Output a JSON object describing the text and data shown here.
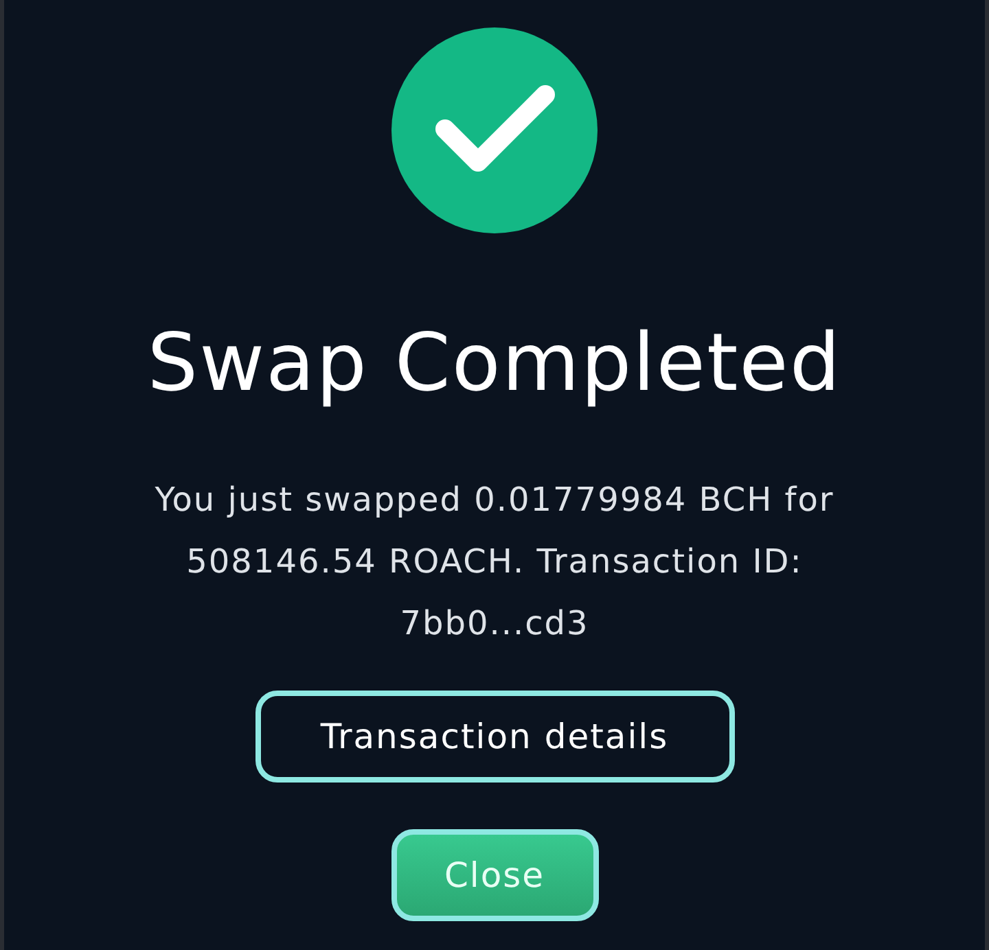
{
  "dialog": {
    "title": "Swap Completed",
    "message": "You just swapped 0.01779984 BCH for 508146.54 ROACH. Transaction ID: 7bb0...cd3",
    "buttons": [
      {
        "label": "Transaction details",
        "kind": "outline"
      },
      {
        "label": "Close",
        "kind": "primary"
      }
    ]
  }
}
